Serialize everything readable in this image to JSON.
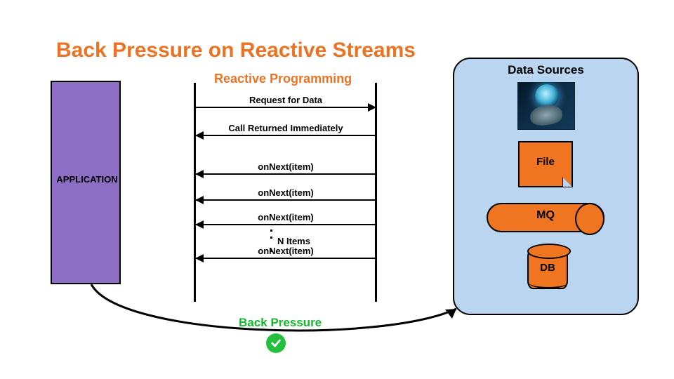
{
  "title": "Back Pressure on Reactive Streams",
  "subtitle": "Reactive Programming",
  "application_label": "APPLICATION",
  "messages": {
    "request": "Request for Data",
    "returned": "Call Returned Immediately",
    "onNext": "onNext(item)",
    "n_items": "N Items"
  },
  "data_sources": {
    "heading": "Data Sources",
    "file": "File",
    "mq": "MQ",
    "db": "DB"
  },
  "back_pressure_label": "Back Pressure",
  "colors": {
    "orange": "#ef7521",
    "purple": "#8c6fc5",
    "panel_blue": "#b9d5f0",
    "green": "#14b92c"
  }
}
